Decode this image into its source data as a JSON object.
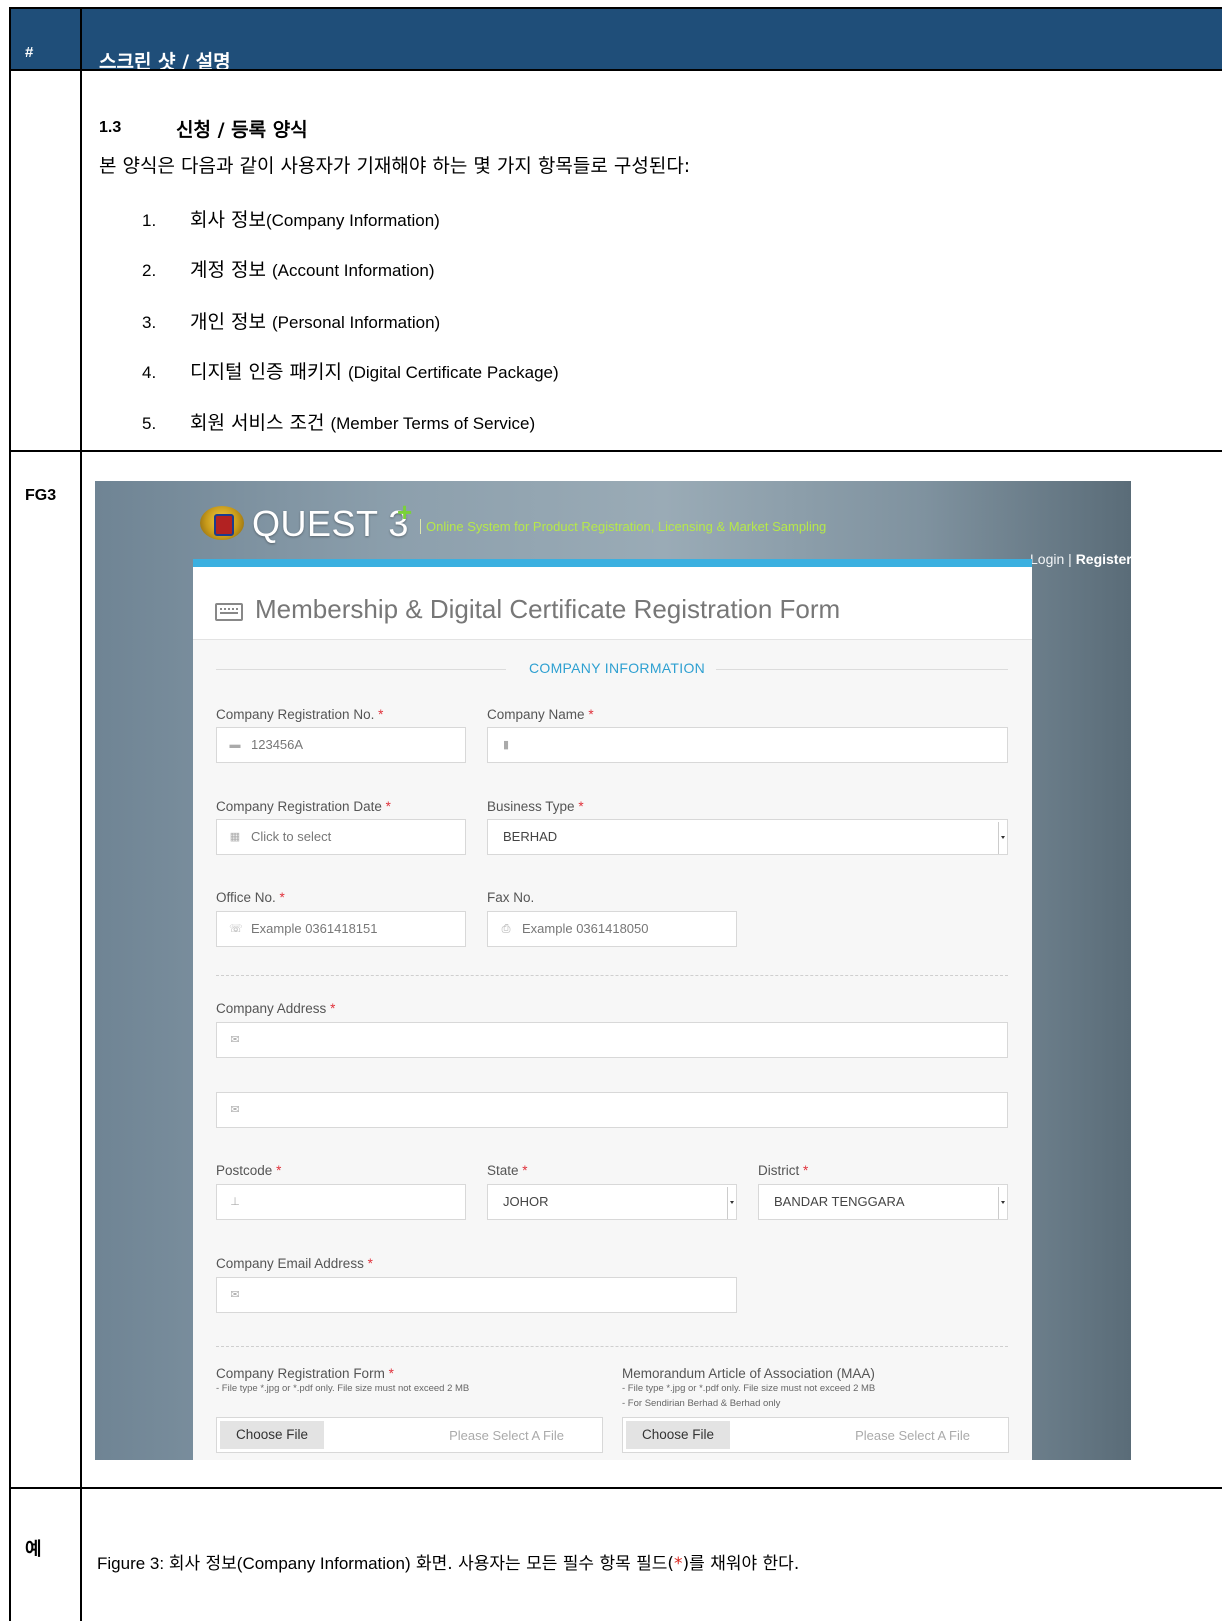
{
  "header": {
    "hash": "#",
    "title": "스크린 샷 / 설명"
  },
  "section": {
    "number": "1.3",
    "title": "신청 / 등록 양식",
    "intro": "본 양식은 다음과 같이 사용자가 기재해야 하는 몇 가지 항목들로 구성된다:",
    "items": [
      {
        "num": "1.",
        "ko": "회사 정보",
        "en": "(Company Information)"
      },
      {
        "num": "2.",
        "ko": "계정 정보 ",
        "en": "(Account Information)"
      },
      {
        "num": "3.",
        "ko": "개인 정보 ",
        "en": "(Personal Information)"
      },
      {
        "num": "4.",
        "ko": "디지털 인증 패키지 ",
        "en": "(Digital Certificate Package)"
      },
      {
        "num": "5.",
        "ko": "회원 서비스 조건 ",
        "en": "(Member Terms of Service)"
      }
    ]
  },
  "rows": {
    "fg3": "FG3",
    "example": "예"
  },
  "screenshot": {
    "brand": "QUEST 3",
    "brand_plus": "+",
    "tagline": "Online System for Product Registration, Licensing & Market Sampling",
    "login": "Login",
    "separator": "|",
    "register": "Register",
    "form_title": "Membership & Digital Certificate Registration Form",
    "section_label": "COMPANY INFORMATION",
    "required_mark": "*",
    "fields": {
      "reg_no": {
        "label": "Company Registration No.",
        "placeholder": "123456A"
      },
      "company_name": {
        "label": "Company Name",
        "placeholder": ""
      },
      "reg_date": {
        "label": "Company Registration Date",
        "placeholder": "Click to select"
      },
      "business_type": {
        "label": "Business Type",
        "value": "BERHAD"
      },
      "office_no": {
        "label": "Office No.",
        "placeholder": "Example 0361418151"
      },
      "fax_no": {
        "label": "Fax No.",
        "placeholder": "Example 0361418050"
      },
      "address": {
        "label": "Company Address"
      },
      "postcode": {
        "label": "Postcode"
      },
      "state": {
        "label": "State",
        "value": "JOHOR"
      },
      "district": {
        "label": "District",
        "value": "BANDAR TENGGARA"
      },
      "email": {
        "label": "Company Email Address"
      },
      "reg_form": {
        "label": "Company Registration Form",
        "note1": "- File type *.jpg or *.pdf only. File size must not exceed 2 MB",
        "button": "Choose File",
        "placeholder": "Please Select A File"
      },
      "maa": {
        "label": "Memorandum Article of Association (MAA)",
        "note1": "- File type *.jpg or *.pdf only. File size must not exceed 2 MB",
        "note2": "- For Sendirian Berhad & Berhad only",
        "button": "Choose File",
        "placeholder": "Please Select A File"
      }
    }
  },
  "caption": {
    "prefix": "Figure 3: ",
    "ko1": "회사 정보",
    "en": "(Company Information)",
    "ko2": " 화면. 사용자는 모든 필수 항목 필드(",
    "star": "*",
    "ko3": ")를 채워야 한다."
  },
  "colors": {
    "header_bg": "#1f4e79",
    "accent": "#3bb0e0",
    "required": "#e0313b"
  }
}
